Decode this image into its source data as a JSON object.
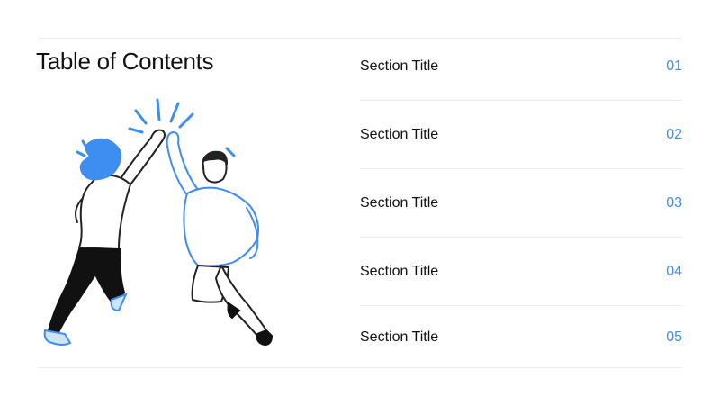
{
  "slide": {
    "title": "Table of Contents"
  },
  "toc": {
    "items": [
      {
        "label": "Section Title",
        "number": "01"
      },
      {
        "label": "Section Title",
        "number": "02"
      },
      {
        "label": "Section Title",
        "number": "03"
      },
      {
        "label": "Section Title",
        "number": "04"
      },
      {
        "label": "Section Title",
        "number": "05"
      }
    ]
  },
  "colors": {
    "accent": "#3d8ef0",
    "text": "#111111",
    "divider": "#ececec"
  },
  "illustration": {
    "icon": "high-five-illustration"
  }
}
